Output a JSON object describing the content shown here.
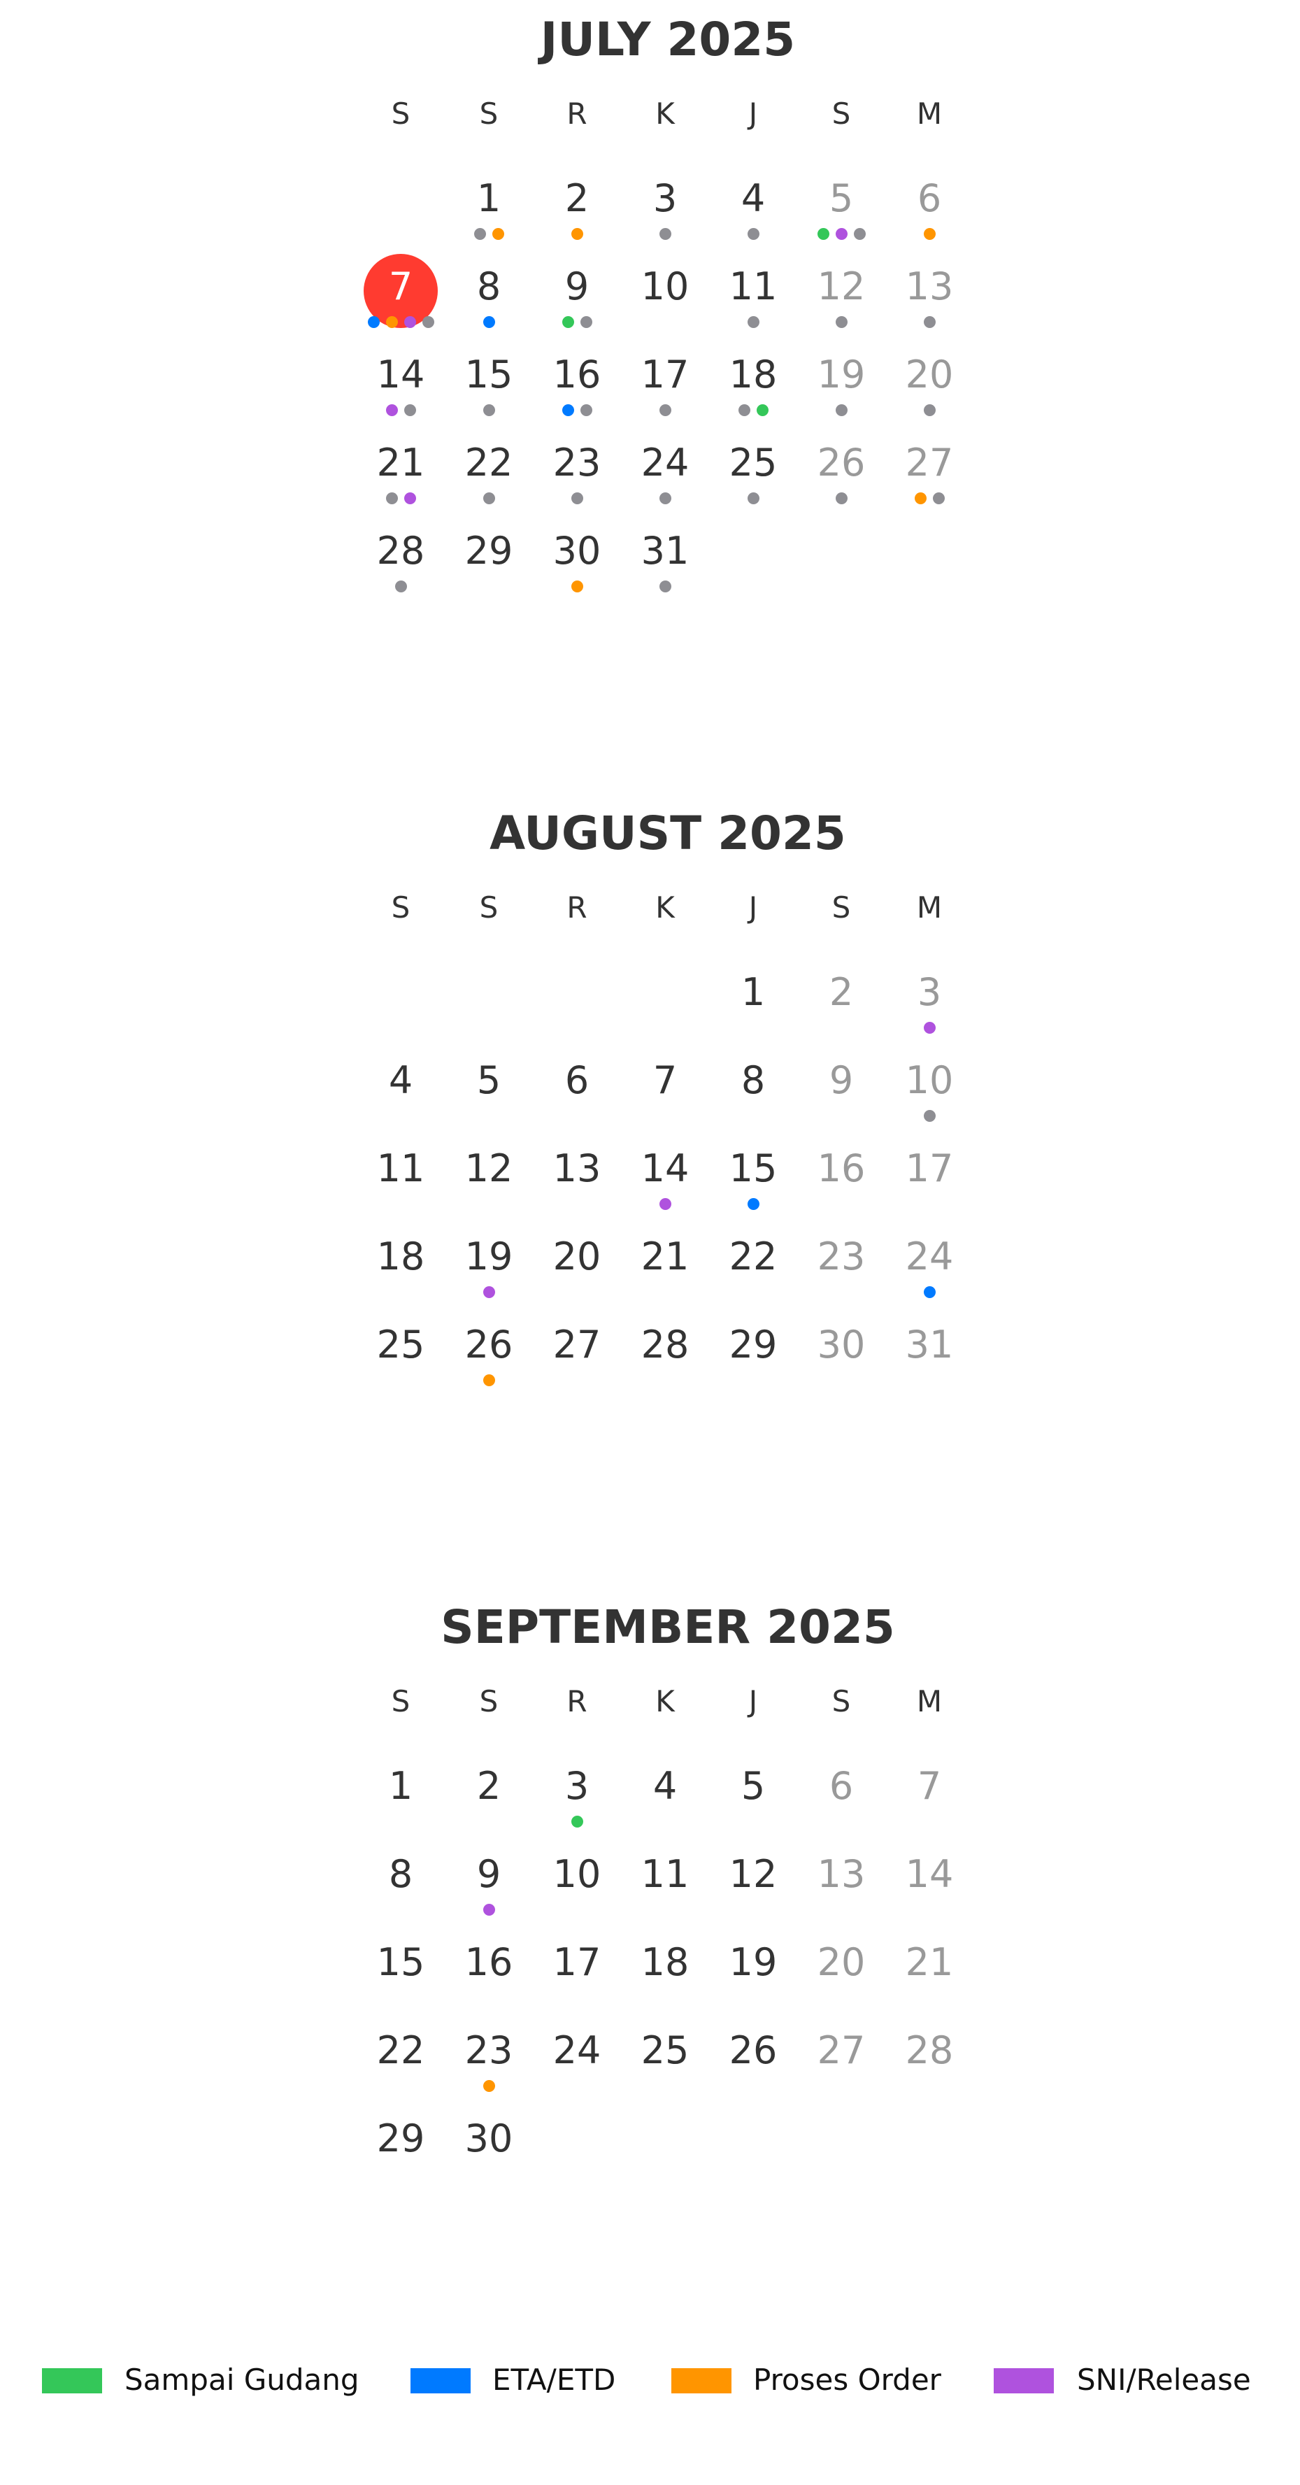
{
  "weekday_headers": [
    "S",
    "S",
    "R",
    "K",
    "J",
    "S",
    "M"
  ],
  "colors": {
    "green": "#34c759",
    "blue": "#007aff",
    "orange": "#ff9500",
    "purple": "#af52de",
    "gray": "#8e8e93",
    "today": "#ff3b30"
  },
  "today": {
    "year": 2025,
    "month": 7,
    "day": 7
  },
  "months": [
    {
      "title": "JULY 2025",
      "year": 2025,
      "month": 7,
      "days_in_month": 31,
      "events": {
        "1": [
          "gray",
          "orange"
        ],
        "2": [
          "orange"
        ],
        "3": [
          "gray"
        ],
        "4": [
          "gray"
        ],
        "5": [
          "green",
          "purple",
          "gray"
        ],
        "6": [
          "orange"
        ],
        "7": [
          "blue",
          "orange",
          "purple",
          "gray"
        ],
        "8": [
          "blue"
        ],
        "9": [
          "green",
          "gray"
        ],
        "11": [
          "gray"
        ],
        "12": [
          "gray"
        ],
        "13": [
          "gray"
        ],
        "14": [
          "purple",
          "gray"
        ],
        "15": [
          "gray"
        ],
        "16": [
          "blue",
          "gray"
        ],
        "17": [
          "gray"
        ],
        "18": [
          "gray",
          "green"
        ],
        "19": [
          "gray"
        ],
        "20": [
          "gray"
        ],
        "21": [
          "gray",
          "purple"
        ],
        "22": [
          "gray"
        ],
        "23": [
          "gray"
        ],
        "24": [
          "gray"
        ],
        "25": [
          "gray"
        ],
        "26": [
          "gray"
        ],
        "27": [
          "orange",
          "gray"
        ],
        "28": [
          "gray"
        ],
        "30": [
          "orange"
        ],
        "31": [
          "gray"
        ]
      }
    },
    {
      "title": "AUGUST 2025",
      "year": 2025,
      "month": 8,
      "days_in_month": 31,
      "events": {
        "3": [
          "purple"
        ],
        "10": [
          "gray"
        ],
        "14": [
          "purple"
        ],
        "15": [
          "blue"
        ],
        "19": [
          "purple"
        ],
        "24": [
          "blue"
        ],
        "26": [
          "orange"
        ]
      }
    },
    {
      "title": "SEPTEMBER 2025",
      "year": 2025,
      "month": 9,
      "days_in_month": 30,
      "events": {
        "3": [
          "green"
        ],
        "9": [
          "purple"
        ],
        "23": [
          "orange"
        ]
      }
    }
  ],
  "legend": [
    {
      "label": "Sampai Gudang",
      "color": "green"
    },
    {
      "label": "ETA/ETD",
      "color": "blue"
    },
    {
      "label": "Proses Order",
      "color": "orange"
    },
    {
      "label": "SNI/Release",
      "color": "purple"
    }
  ]
}
